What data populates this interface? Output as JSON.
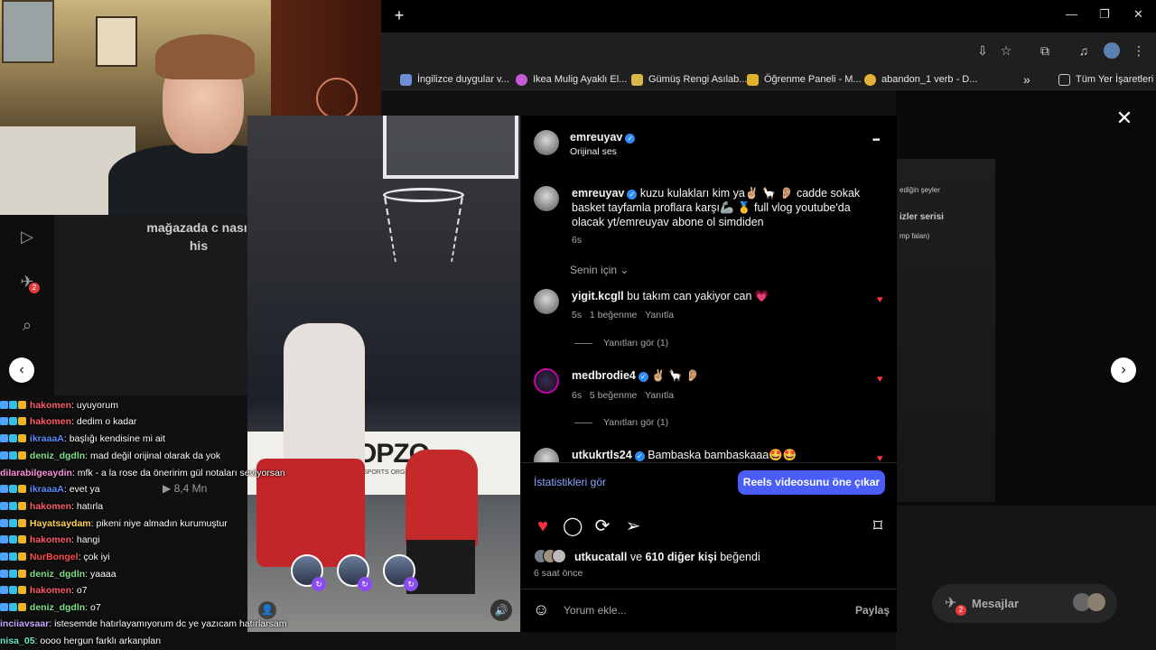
{
  "browser": {
    "new_tab": "+",
    "minimize": "—",
    "restore": "❐",
    "close": "✕",
    "bookmarks": [
      {
        "label": "İngilizce duygular v...",
        "color": "#6d8ed8"
      },
      {
        "label": "Ikea Mulig Ayaklı El...",
        "color": "#c65bd6"
      },
      {
        "label": "Gümüş Rengi Asılab...",
        "color": "#d9b84a"
      },
      {
        "label": "Öğrenme Paneli - M...",
        "color": "#e0b12b"
      },
      {
        "label": "abandon_1 verb - D...",
        "color": "#e6b23a"
      }
    ],
    "bookmarks_more": "»",
    "all_bookmarks": "Tüm Yer İşaretleri"
  },
  "left_reel": {
    "text": "mağazada c nasıl his",
    "views": "8,4 Mn"
  },
  "chat": [
    {
      "user": "hakomen",
      "color": "#ff5b6b",
      "msg": ": uyuyorum"
    },
    {
      "user": "hakomen",
      "color": "#ff5b6b",
      "msg": ": dedim o kadar"
    },
    {
      "user": "ikraaaA",
      "color": "#5b8cff",
      "msg": ": başlığı kendisine mi ait"
    },
    {
      "user": "deniz_dgdln",
      "color": "#7ee08a",
      "msg": ": mad değil orijinal olarak da yok"
    },
    {
      "user": "dilarabilgeaydin",
      "color": "#ff8fd8",
      "msg": ": mfk - a la rose da öneririm gül notaları seviyorsan"
    },
    {
      "user": "ikraaaA",
      "color": "#5b8cff",
      "msg": ": evet ya"
    },
    {
      "user": "hakomen",
      "color": "#ff5b6b",
      "msg": ": hatırla"
    },
    {
      "user": "Hayatsaydam",
      "color": "#ffd34d",
      "msg": ": pikeni niye almadın kurumuştur"
    },
    {
      "user": "hakomen",
      "color": "#ff5b6b",
      "msg": ": hangi"
    },
    {
      "user": "NurBongel",
      "color": "#ff4d4d",
      "msg": ": çok iyi"
    },
    {
      "user": "deniz_dgdln",
      "color": "#7ee08a",
      "msg": ": yaaaa"
    },
    {
      "user": "hakomen",
      "color": "#ff5b6b",
      "msg": ": o7"
    },
    {
      "user": "deniz_dgdln",
      "color": "#7ee08a",
      "msg": ": o7"
    },
    {
      "user": "inciiavsaar",
      "color": "#c9a6ff",
      "msg": ": istesemde hatırlayamıyorum dc ye yazıcam hatırlarsam"
    },
    {
      "user": "nisa_05",
      "color": "#6ee6c8",
      "msg": ": oooo hergun farklı arkanplan"
    }
  ],
  "video": {
    "banner": "OPZO",
    "banner_sub": "SPORTS ORGANIZ"
  },
  "post": {
    "author": "emreuyav",
    "audio": "Orijinal ses",
    "caption_user": "emreuyav",
    "caption": "kuzu kulakları kim ya✌🏼 🦙 👂🏼 cadde sokak basket tayfamla proflara karşı🦾 🥇 full vlog youtube'da olacak yt/emreuyav abone ol simdiden",
    "caption_time": "6s",
    "sort_label": "Senin için",
    "comments": [
      {
        "user": "yigit.kcgll",
        "text": "bu takım can yakiyor can 💗",
        "time": "5s",
        "likes": "1 beğenme",
        "reply": "Yanıtla",
        "replies": "Yanıtları gör (1)",
        "verified": false
      },
      {
        "user": "medbrodie4",
        "text": "✌🏼 🦙 👂🏼",
        "time": "6s",
        "likes": "5 beğenme",
        "reply": "Yanıtla",
        "replies": "Yanıtları gör (1)",
        "verified": true
      },
      {
        "user": "utkukrtls24",
        "text": "Bambaska bambaskaaa🤩🤩",
        "verified": true
      }
    ],
    "insights": "İstatistikleri gör",
    "boost": "Reels videosunu öne çıkar",
    "liked_by_user": "utkucatall",
    "liked_by_rest": "ve",
    "liked_by_count": "610 diğer kişi",
    "liked_by_suffix": "beğendi",
    "time_ago": "6 saat önce",
    "comment_placeholder": "Yorum ekle...",
    "share": "Paylaş",
    "more": "•••"
  },
  "right_bg": {
    "texts": [
      "ediğin şeyler",
      "izler serisi",
      "mp falan)"
    ]
  },
  "messages": {
    "label": "Mesajlar",
    "badge": "2"
  },
  "sidebar_badge": "2"
}
